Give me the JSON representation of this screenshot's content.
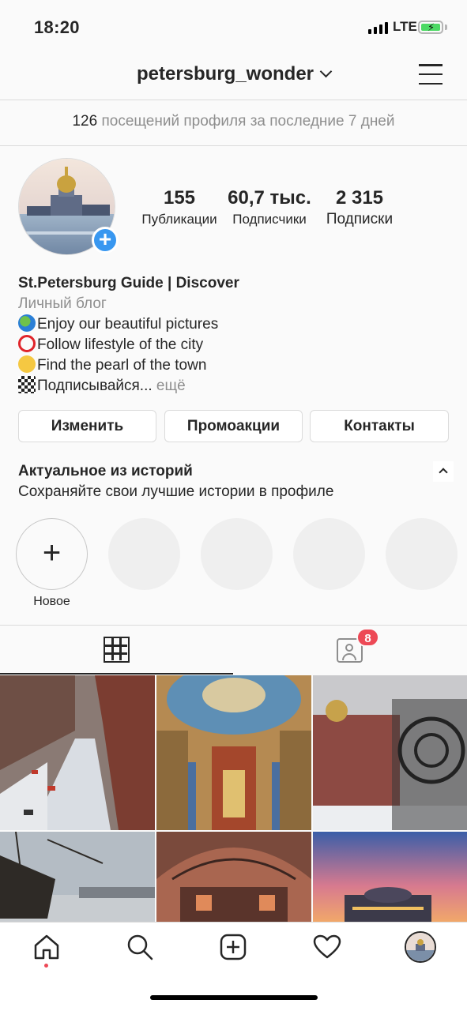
{
  "status_bar": {
    "time": "18:20",
    "network": "LTE"
  },
  "header": {
    "username": "petersburg_wonder"
  },
  "insights": {
    "count": "126",
    "text": "посещений профиля за последние 7 дней"
  },
  "profile": {
    "stats": [
      {
        "value": "155",
        "label": "Публикации"
      },
      {
        "value": "60,7 тыс.",
        "label": "Подписчики"
      },
      {
        "value": "2 315",
        "label": "Подписки"
      }
    ],
    "name": "St.Petersburg Guide | Discover",
    "category": "Личный блог",
    "bio_lines": [
      "Enjoy our beautiful pictures",
      "Follow lifestyle of the city",
      "Find the pearl of the town",
      "Подписывайся..."
    ],
    "more_label": "ещё"
  },
  "buttons": {
    "edit": "Изменить",
    "promo": "Промоакции",
    "contacts": "Контакты"
  },
  "highlights": {
    "title": "Актуальное из историй",
    "subtitle": "Сохраняйте свои лучшие истории в профиле",
    "new_label": "Новое"
  },
  "tabs": {
    "tagged_badge": "8"
  },
  "colors": {
    "accent": "#3897f0",
    "badge": "#ed4956",
    "text": "#262626",
    "muted": "#8e8e8e"
  },
  "nav": [
    "home-icon",
    "search-icon",
    "new-post-icon",
    "activity-icon",
    "profile-avatar"
  ]
}
